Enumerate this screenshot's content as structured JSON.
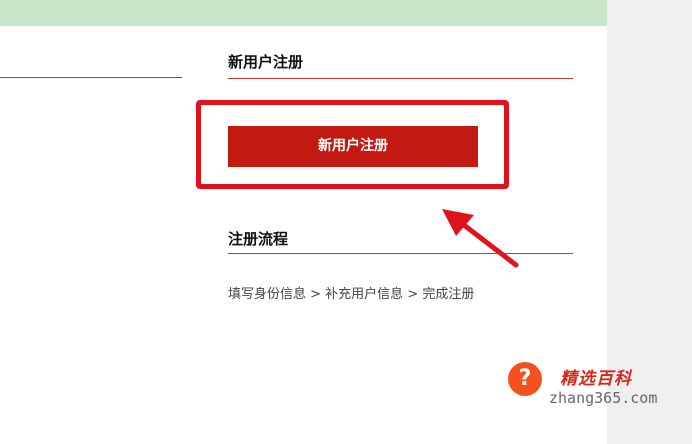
{
  "section_register": {
    "title": "新用户注册"
  },
  "register_button": {
    "label": "新用户注册"
  },
  "section_flow": {
    "title": "注册流程",
    "steps_text": "填写身份信息 > 补充用户信息 > 完成注册"
  },
  "watermark": {
    "icon_text": "?",
    "brand": "精选百科",
    "domain": "zhang365.com"
  },
  "colors": {
    "accent": "#c21a10",
    "highlight": "#e0121b",
    "top_bar": "#c9e6cb"
  },
  "icons": {
    "annotation_arrow": "red-arrow-icon"
  }
}
